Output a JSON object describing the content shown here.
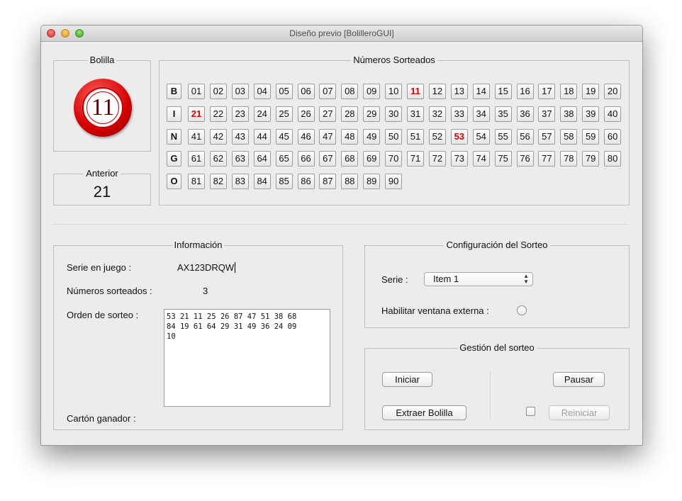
{
  "window": {
    "title": "Diseño previo [BolilleroGUI]"
  },
  "bolilla": {
    "label": "Bolilla",
    "value": "11"
  },
  "anterior": {
    "label": "Anterior",
    "value": "21"
  },
  "numeros": {
    "label": "Números Sorteados",
    "rows": [
      {
        "letter": "B",
        "numbers": [
          "01",
          "02",
          "03",
          "04",
          "05",
          "06",
          "07",
          "08",
          "09",
          "10",
          "11",
          "12",
          "13",
          "14",
          "15",
          "16",
          "17",
          "18",
          "19",
          "20"
        ]
      },
      {
        "letter": "I",
        "numbers": [
          "21",
          "22",
          "23",
          "24",
          "25",
          "26",
          "27",
          "28",
          "29",
          "30",
          "31",
          "32",
          "33",
          "34",
          "35",
          "36",
          "37",
          "38",
          "39",
          "40"
        ]
      },
      {
        "letter": "N",
        "numbers": [
          "41",
          "42",
          "43",
          "44",
          "45",
          "46",
          "47",
          "48",
          "49",
          "50",
          "51",
          "52",
          "53",
          "54",
          "55",
          "56",
          "57",
          "58",
          "59",
          "60"
        ]
      },
      {
        "letter": "G",
        "numbers": [
          "61",
          "62",
          "63",
          "64",
          "65",
          "66",
          "67",
          "68",
          "69",
          "70",
          "71",
          "72",
          "73",
          "74",
          "75",
          "76",
          "77",
          "78",
          "79",
          "80"
        ]
      },
      {
        "letter": "O",
        "numbers": [
          "81",
          "82",
          "83",
          "84",
          "85",
          "86",
          "87",
          "88",
          "89",
          "90"
        ]
      }
    ],
    "drawn": [
      "11",
      "21",
      "53"
    ],
    "drawn_color": "#d40000"
  },
  "informacion": {
    "label": "Información",
    "serie_label": "Serie en juego :",
    "serie_value": "AX123DRQW",
    "sorteados_label": "Números sorteados :",
    "sorteados_value": "3",
    "orden_label": "Orden de sorteo :",
    "orden_value": "53 21 11 25 26 87 47 51 38 68\n84 19 61 64 29 31 49 36 24 09\n10",
    "carton_label": "Cartón ganador :"
  },
  "configuracion": {
    "label": "Configuración del Sorteo",
    "serie_label": "Serie :",
    "serie_selected": "Item 1",
    "externa_label": "Habilitar ventana externa :"
  },
  "gestion": {
    "label": "Gestión del sorteo",
    "iniciar": "Iniciar",
    "pausar": "Pausar",
    "extraer": "Extraer Bolilla",
    "reiniciar": "Reiniciar"
  }
}
